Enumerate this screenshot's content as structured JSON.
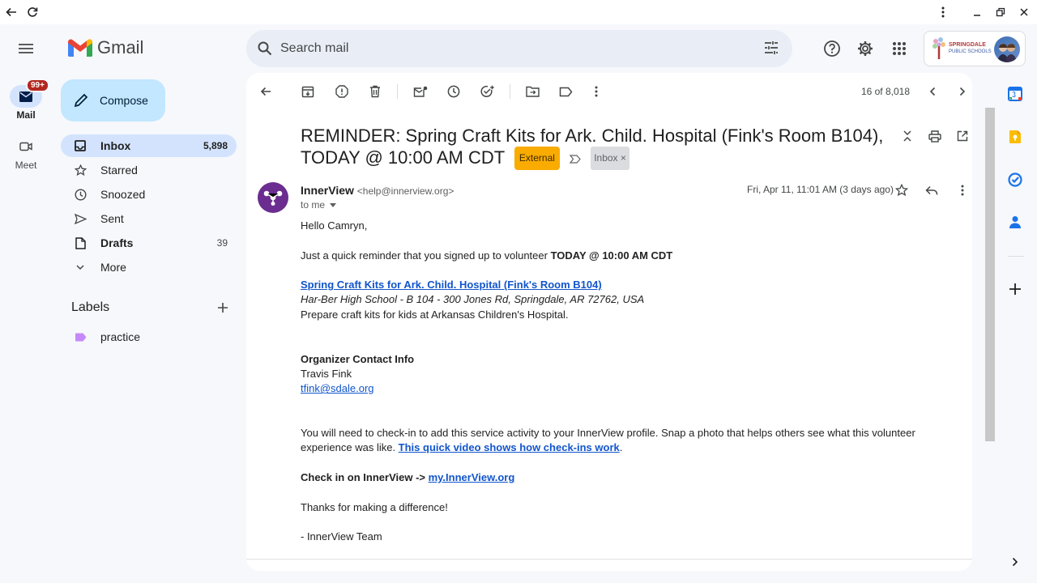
{
  "app": {
    "name": "Gmail"
  },
  "rail": {
    "mail_label": "Mail",
    "mail_badge": "99+",
    "meet_label": "Meet"
  },
  "search": {
    "placeholder": "Search mail"
  },
  "compose": {
    "label": "Compose"
  },
  "nav": {
    "items": [
      {
        "label": "Inbox",
        "count": "5,898",
        "icon": "inbox-icon"
      },
      {
        "label": "Starred",
        "count": "",
        "icon": "star-icon"
      },
      {
        "label": "Snoozed",
        "count": "",
        "icon": "clock-icon"
      },
      {
        "label": "Sent",
        "count": "",
        "icon": "send-icon"
      },
      {
        "label": "Drafts",
        "count": "39",
        "icon": "draft-icon"
      },
      {
        "label": "More",
        "count": "",
        "icon": "chevron-down-icon"
      }
    ],
    "labels_title": "Labels",
    "labels": [
      {
        "label": "practice",
        "color": "#c58af9"
      }
    ]
  },
  "account": {
    "school_line1": "SPRINGDALE",
    "school_line2": "PUBLIC SCHOOLS"
  },
  "toolbar": {
    "pager": "16 of 8,018"
  },
  "email": {
    "subject": "REMINDER: Spring Craft Kits for Ark. Child. Hospital (Fink's Room B104), TODAY @ 10:00 AM CDT",
    "tag_external": "External",
    "tag_inbox": "Inbox",
    "tag_inbox_close": "×",
    "sender_name": "InnerView",
    "sender_email": "<help@innerview.org>",
    "to": "to me",
    "date": "Fri, Apr 11, 11:01 AM (3 days ago)",
    "greeting": "Hello Camryn,",
    "reminder_prefix": "Just a quick reminder that you signed up to volunteer ",
    "reminder_bold": "TODAY @ 10:00 AM CDT",
    "event_link": "Spring Craft Kits for Ark. Child. Hospital (Fink's Room B104)",
    "event_location": "Har-Ber High School - B 104 - 300 Jones Rd, Springdale, AR 72762, USA",
    "event_desc": "Prepare craft kits for kids at Arkansas Children's Hospital.",
    "organizer_title": "Organizer Contact Info",
    "organizer_name": "Travis Fink",
    "organizer_email": "tfink@sdale.org",
    "checkin_text": "You will need to check-in to add this service activity to your InnerView profile. Snap a photo that helps others see what this volunteer experience was like. ",
    "checkin_link": "This quick video shows how check-ins work",
    "checkin_period": ".",
    "checkin_prompt": "Check in on InnerView -> ",
    "checkin_site": "my.InnerView.org",
    "thanks": "Thanks for making a difference!",
    "signoff": "- InnerView Team"
  },
  "colors": {
    "accent": "#0b57d0",
    "active_nav": "#d3e3fd",
    "compose_bg": "#c2e7ff",
    "external_tag": "#f9ab00",
    "sender_avatar": "#6b2d8f"
  }
}
